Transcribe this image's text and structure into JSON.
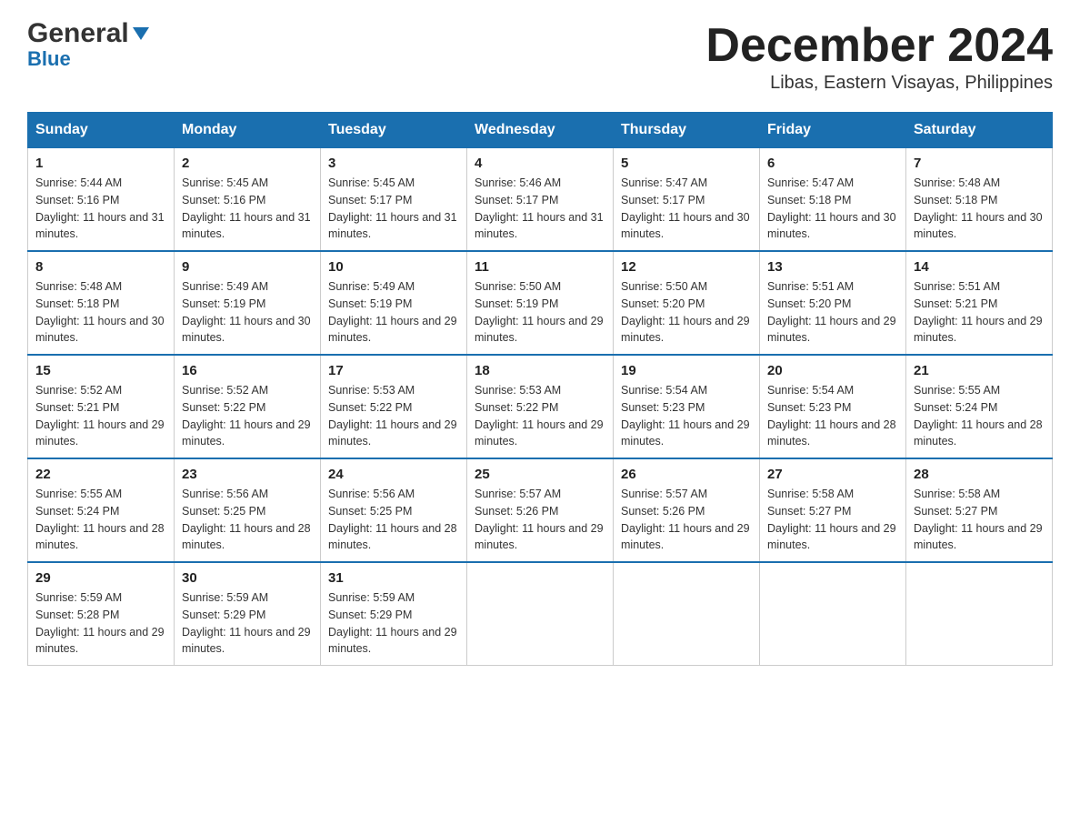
{
  "header": {
    "logo_general": "General",
    "logo_blue": "Blue",
    "title": "December 2024",
    "subtitle": "Libas, Eastern Visayas, Philippines"
  },
  "days": [
    "Sunday",
    "Monday",
    "Tuesday",
    "Wednesday",
    "Thursday",
    "Friday",
    "Saturday"
  ],
  "weeks": [
    [
      {
        "num": "1",
        "sunrise": "5:44 AM",
        "sunset": "5:16 PM",
        "daylight": "11 hours and 31 minutes."
      },
      {
        "num": "2",
        "sunrise": "5:45 AM",
        "sunset": "5:16 PM",
        "daylight": "11 hours and 31 minutes."
      },
      {
        "num": "3",
        "sunrise": "5:45 AM",
        "sunset": "5:17 PM",
        "daylight": "11 hours and 31 minutes."
      },
      {
        "num": "4",
        "sunrise": "5:46 AM",
        "sunset": "5:17 PM",
        "daylight": "11 hours and 31 minutes."
      },
      {
        "num": "5",
        "sunrise": "5:47 AM",
        "sunset": "5:17 PM",
        "daylight": "11 hours and 30 minutes."
      },
      {
        "num": "6",
        "sunrise": "5:47 AM",
        "sunset": "5:18 PM",
        "daylight": "11 hours and 30 minutes."
      },
      {
        "num": "7",
        "sunrise": "5:48 AM",
        "sunset": "5:18 PM",
        "daylight": "11 hours and 30 minutes."
      }
    ],
    [
      {
        "num": "8",
        "sunrise": "5:48 AM",
        "sunset": "5:18 PM",
        "daylight": "11 hours and 30 minutes."
      },
      {
        "num": "9",
        "sunrise": "5:49 AM",
        "sunset": "5:19 PM",
        "daylight": "11 hours and 30 minutes."
      },
      {
        "num": "10",
        "sunrise": "5:49 AM",
        "sunset": "5:19 PM",
        "daylight": "11 hours and 29 minutes."
      },
      {
        "num": "11",
        "sunrise": "5:50 AM",
        "sunset": "5:19 PM",
        "daylight": "11 hours and 29 minutes."
      },
      {
        "num": "12",
        "sunrise": "5:50 AM",
        "sunset": "5:20 PM",
        "daylight": "11 hours and 29 minutes."
      },
      {
        "num": "13",
        "sunrise": "5:51 AM",
        "sunset": "5:20 PM",
        "daylight": "11 hours and 29 minutes."
      },
      {
        "num": "14",
        "sunrise": "5:51 AM",
        "sunset": "5:21 PM",
        "daylight": "11 hours and 29 minutes."
      }
    ],
    [
      {
        "num": "15",
        "sunrise": "5:52 AM",
        "sunset": "5:21 PM",
        "daylight": "11 hours and 29 minutes."
      },
      {
        "num": "16",
        "sunrise": "5:52 AM",
        "sunset": "5:22 PM",
        "daylight": "11 hours and 29 minutes."
      },
      {
        "num": "17",
        "sunrise": "5:53 AM",
        "sunset": "5:22 PM",
        "daylight": "11 hours and 29 minutes."
      },
      {
        "num": "18",
        "sunrise": "5:53 AM",
        "sunset": "5:22 PM",
        "daylight": "11 hours and 29 minutes."
      },
      {
        "num": "19",
        "sunrise": "5:54 AM",
        "sunset": "5:23 PM",
        "daylight": "11 hours and 29 minutes."
      },
      {
        "num": "20",
        "sunrise": "5:54 AM",
        "sunset": "5:23 PM",
        "daylight": "11 hours and 28 minutes."
      },
      {
        "num": "21",
        "sunrise": "5:55 AM",
        "sunset": "5:24 PM",
        "daylight": "11 hours and 28 minutes."
      }
    ],
    [
      {
        "num": "22",
        "sunrise": "5:55 AM",
        "sunset": "5:24 PM",
        "daylight": "11 hours and 28 minutes."
      },
      {
        "num": "23",
        "sunrise": "5:56 AM",
        "sunset": "5:25 PM",
        "daylight": "11 hours and 28 minutes."
      },
      {
        "num": "24",
        "sunrise": "5:56 AM",
        "sunset": "5:25 PM",
        "daylight": "11 hours and 28 minutes."
      },
      {
        "num": "25",
        "sunrise": "5:57 AM",
        "sunset": "5:26 PM",
        "daylight": "11 hours and 29 minutes."
      },
      {
        "num": "26",
        "sunrise": "5:57 AM",
        "sunset": "5:26 PM",
        "daylight": "11 hours and 29 minutes."
      },
      {
        "num": "27",
        "sunrise": "5:58 AM",
        "sunset": "5:27 PM",
        "daylight": "11 hours and 29 minutes."
      },
      {
        "num": "28",
        "sunrise": "5:58 AM",
        "sunset": "5:27 PM",
        "daylight": "11 hours and 29 minutes."
      }
    ],
    [
      {
        "num": "29",
        "sunrise": "5:59 AM",
        "sunset": "5:28 PM",
        "daylight": "11 hours and 29 minutes."
      },
      {
        "num": "30",
        "sunrise": "5:59 AM",
        "sunset": "5:29 PM",
        "daylight": "11 hours and 29 minutes."
      },
      {
        "num": "31",
        "sunrise": "5:59 AM",
        "sunset": "5:29 PM",
        "daylight": "11 hours and 29 minutes."
      },
      null,
      null,
      null,
      null
    ]
  ]
}
